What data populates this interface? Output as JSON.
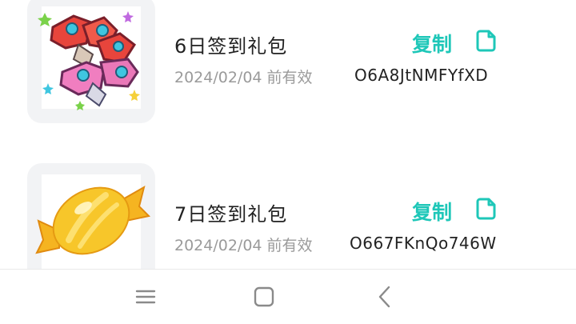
{
  "items": [
    {
      "title": "6日签到礼包",
      "date_text": "2024/02/04 前有效",
      "code": "O6A8JtNMFYfXD",
      "copy_label": "复制",
      "copy_icon": "copy-icon",
      "thumbnail": "red-and-pink-gems-icon"
    },
    {
      "title": "7日签到礼包",
      "date_text": "2024/02/04 前有效",
      "code": "O667FKnQo746W",
      "copy_label": "复制",
      "copy_icon": "copy-icon",
      "thumbnail": "candy-icon"
    }
  ],
  "navbar": {
    "menu_icon": "menu-icon",
    "home_icon": "home-square-icon",
    "back_icon": "back-chevron-icon"
  },
  "colors": {
    "accent": "#1ec7b8",
    "title_text": "#222222",
    "secondary_text": "#9a9a9a",
    "thumb_bg": "#f2f3f5"
  }
}
